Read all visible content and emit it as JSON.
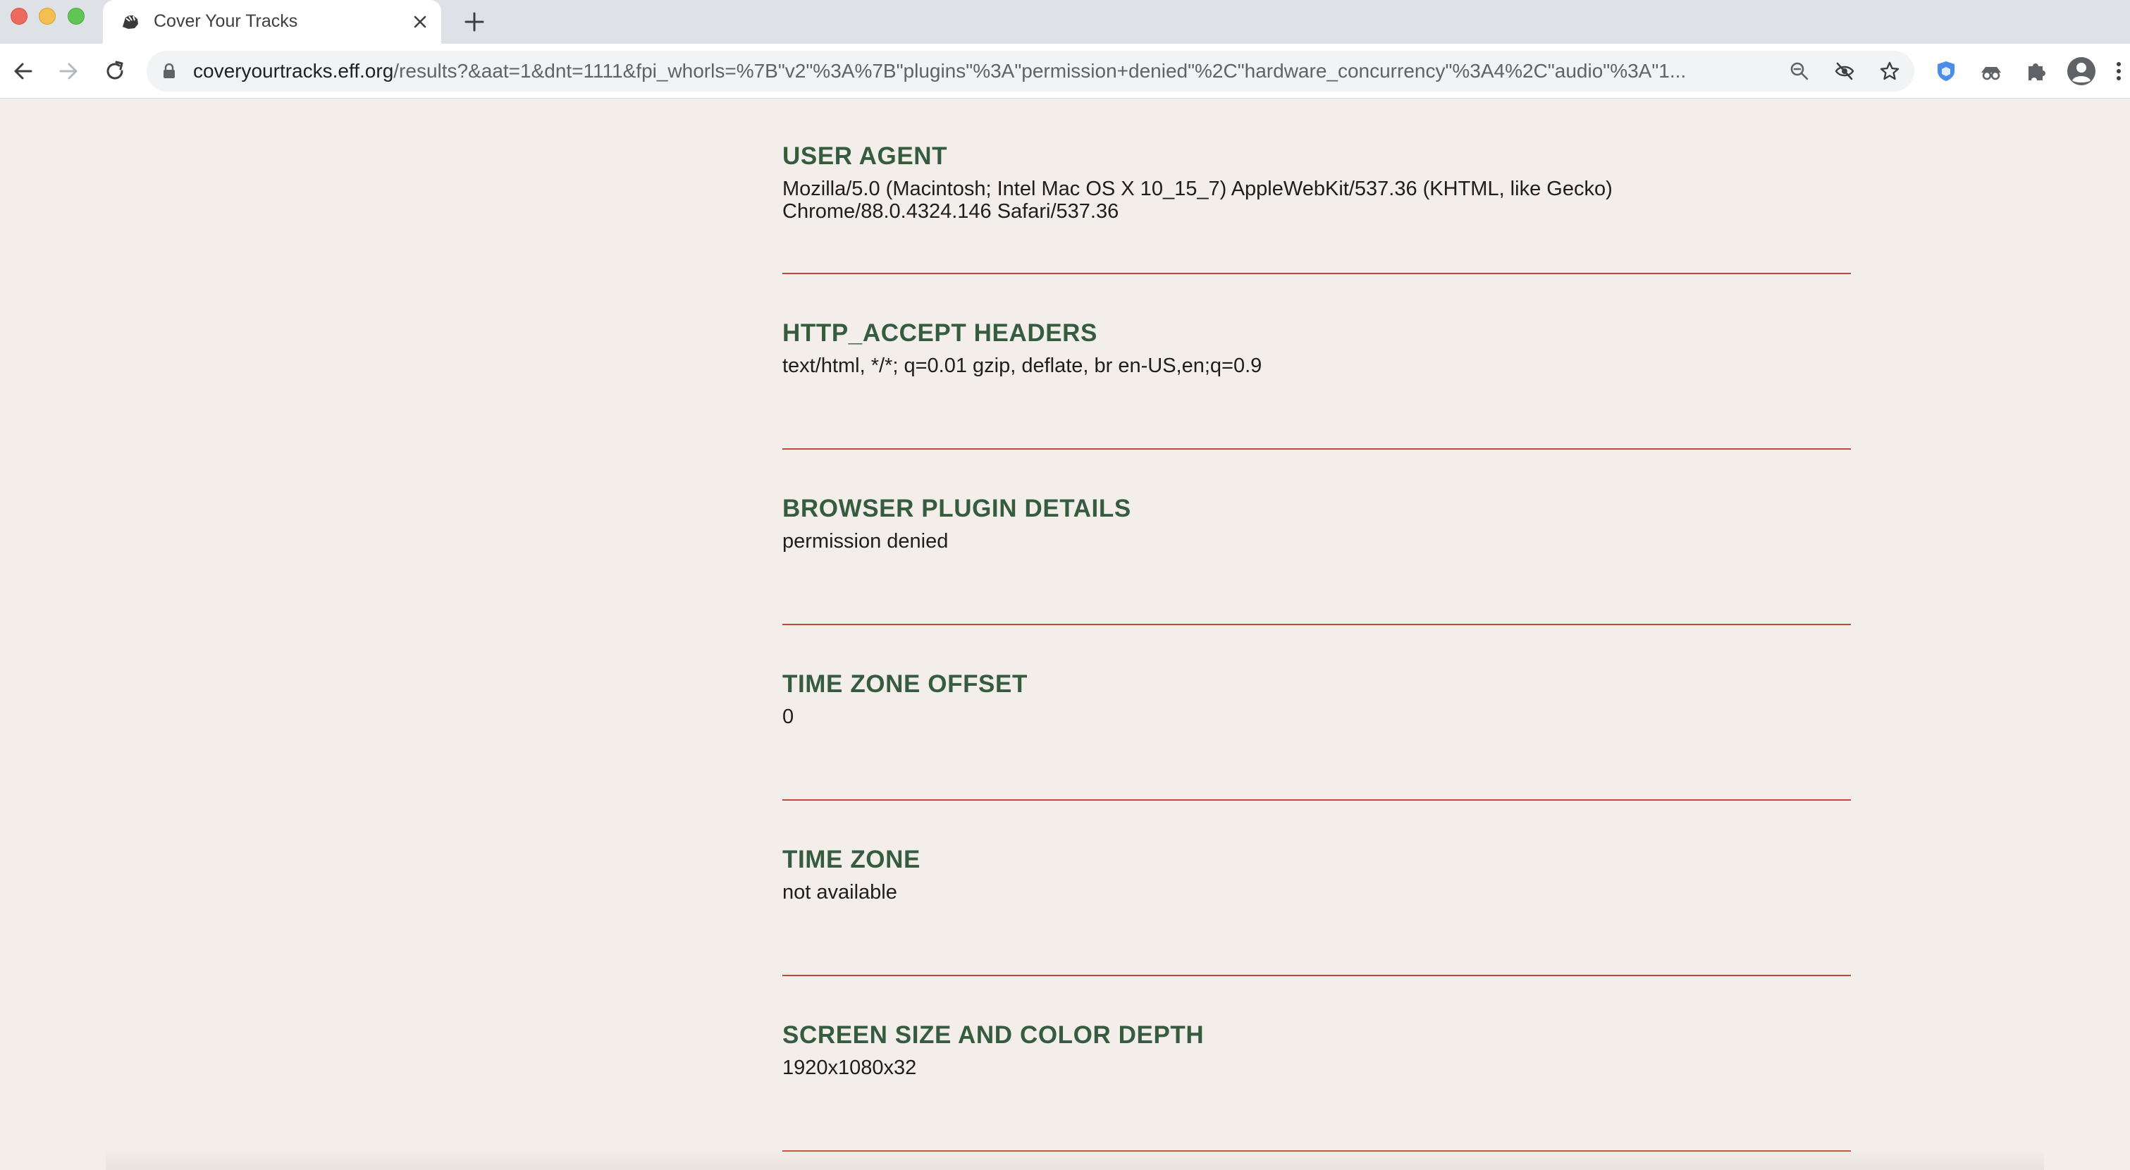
{
  "browser": {
    "tab": {
      "title": "Cover Your Tracks",
      "favicon": "eff-tracks-icon"
    },
    "address": {
      "host": "coveryourtracks.eff.org",
      "path": "/results?&aat=1&dnt=1111&fpi_whorls=%7B\"v2\"%3A%7B\"plugins\"%3A\"permission+denied\"%2C\"hardware_concurrency\"%3A4%2C\"audio\"%3A\"1..."
    },
    "icons": [
      "back-icon",
      "forward-icon",
      "reload-icon",
      "lock-icon",
      "zoom-icon",
      "tracking-blocked-icon",
      "star-icon",
      "privacy-badger-icon",
      "disguise-extension-icon",
      "puzzle-extensions-icon",
      "profile-avatar-icon",
      "kebab-menu-icon"
    ]
  },
  "colors": {
    "page_bg": "#f3eeea",
    "heading": "#355c3f",
    "divider": "#c0473a"
  },
  "sections": [
    {
      "title": "USER AGENT",
      "value": "Mozilla/5.0 (Macintosh; Intel Mac OS X 10_15_7) AppleWebKit/537.36 (KHTML, like Gecko) Chrome/88.0.4324.146 Safari/537.36"
    },
    {
      "title": "HTTP_ACCEPT HEADERS",
      "value": "text/html, */*; q=0.01 gzip, deflate, br en-US,en;q=0.9"
    },
    {
      "title": "BROWSER PLUGIN DETAILS",
      "value": "permission denied"
    },
    {
      "title": "TIME ZONE OFFSET",
      "value": "0"
    },
    {
      "title": "TIME ZONE",
      "value": "not available"
    },
    {
      "title": "SCREEN SIZE AND COLOR DEPTH",
      "value": "1920x1080x32"
    }
  ]
}
